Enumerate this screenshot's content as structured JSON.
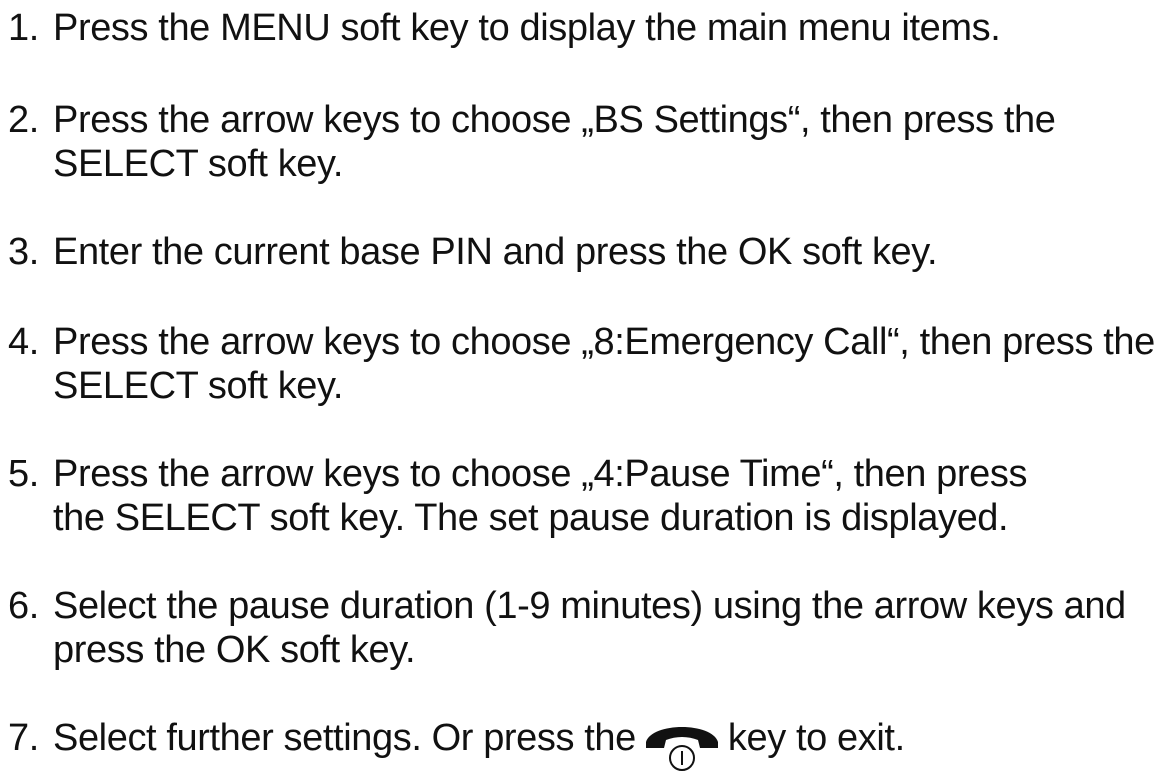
{
  "steps": [
    {
      "number": "1.",
      "line1": "Press the MENU soft key to display the main menu items."
    },
    {
      "number": "2.",
      "line1": "Press the arrow keys to choose „BS Settings“, then press the",
      "line2": "SELECT soft key."
    },
    {
      "number": "3.",
      "line1": "Enter the current base PIN and press the OK soft key."
    },
    {
      "number": "4.",
      "line1": "Press the arrow keys to choose „8:Emergency Call“, then press the",
      "line2": "SELECT soft key."
    },
    {
      "number": "5.",
      "line1": "Press the arrow keys to choose „4:Pause Time“, then press",
      "line2": "the SELECT soft key. The set pause duration is displayed."
    },
    {
      "number": "6.",
      "line1": "Select the pause duration (1-9 minutes) using the arrow keys and",
      "line2": "press the OK soft key."
    },
    {
      "number": "7.",
      "line1_before": "Select further settings. Or press the",
      "line1_after": "key to exit.",
      "icon": "end-call-key-icon"
    }
  ]
}
